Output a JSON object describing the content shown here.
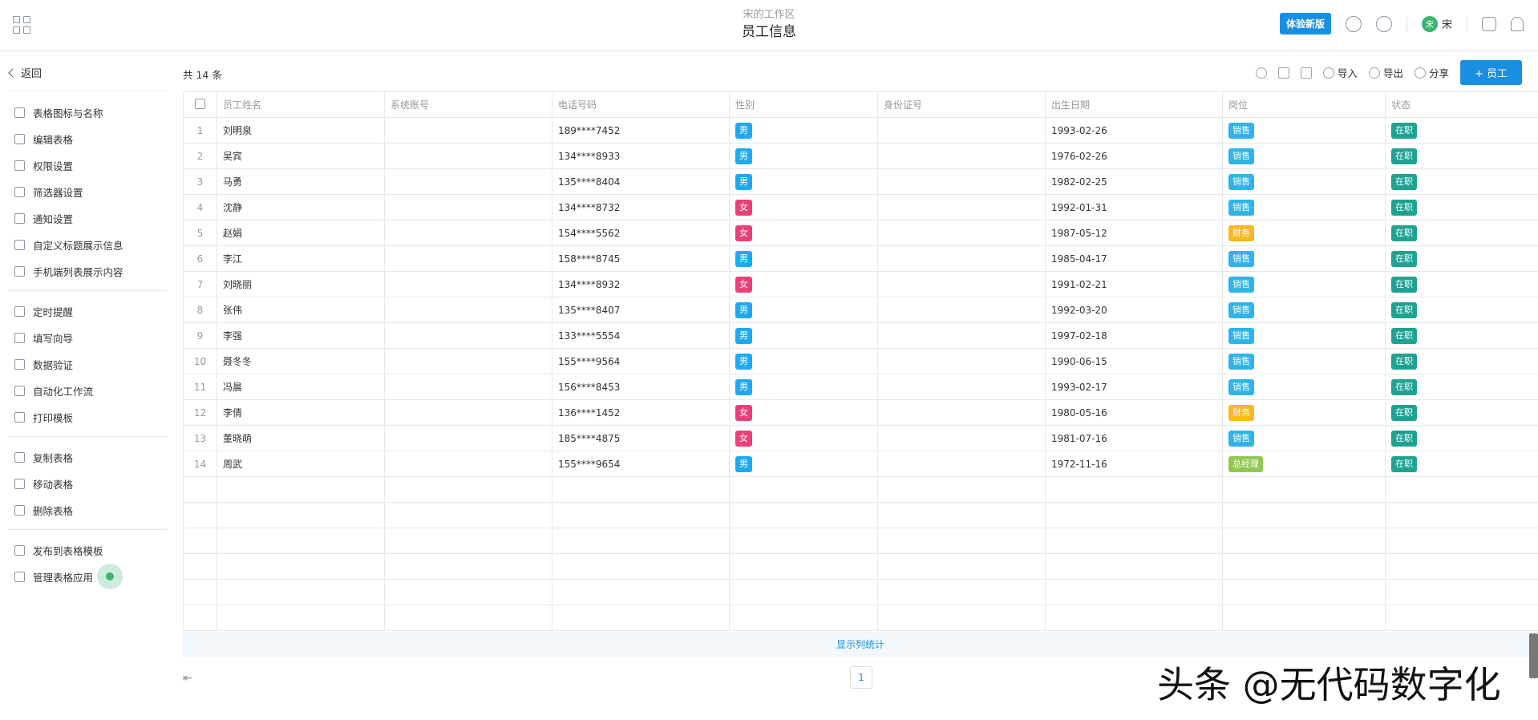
{
  "header": {
    "workspace": "宋的工作区",
    "title": "员工信息",
    "beta_label": "体验新版",
    "user_initial": "宋",
    "user_name": "宋"
  },
  "sidebar": {
    "back_label": "返回",
    "groups": [
      [
        "表格图标与名称",
        "编辑表格",
        "权限设置",
        "筛选器设置",
        "通知设置",
        "自定义标题展示信息",
        "手机端列表展示内容"
      ],
      [
        "定时提醒",
        "填写向导",
        "数据验证",
        "自动化工作流",
        "打印模板"
      ],
      [
        "复制表格",
        "移动表格",
        "删除表格"
      ],
      [
        "发布到表格模板",
        "管理表格应用"
      ]
    ]
  },
  "toolbar": {
    "count": "共 14 条",
    "import": "导入",
    "export": "导出",
    "share": "分享",
    "add": "+ 员工"
  },
  "table": {
    "columns": [
      "员工姓名",
      "系统账号",
      "电话号码",
      "性别",
      "身份证号",
      "出生日期",
      "岗位",
      "状态"
    ],
    "rows": [
      {
        "n": "1",
        "name": "刘明泉",
        "phone": "189****7452",
        "gender": "男",
        "birth": "1993-02-26",
        "post": "销售",
        "status": "在职"
      },
      {
        "n": "2",
        "name": "吴宾",
        "phone": "134****8933",
        "gender": "男",
        "birth": "1976-02-26",
        "post": "销售",
        "status": "在职"
      },
      {
        "n": "3",
        "name": "马勇",
        "phone": "135****8404",
        "gender": "男",
        "birth": "1982-02-25",
        "post": "销售",
        "status": "在职"
      },
      {
        "n": "4",
        "name": "沈静",
        "phone": "134****8732",
        "gender": "女",
        "birth": "1992-01-31",
        "post": "销售",
        "status": "在职"
      },
      {
        "n": "5",
        "name": "赵娟",
        "phone": "154****5562",
        "gender": "女",
        "birth": "1987-05-12",
        "post": "财务",
        "status": "在职"
      },
      {
        "n": "6",
        "name": "李江",
        "phone": "158****8745",
        "gender": "男",
        "birth": "1985-04-17",
        "post": "销售",
        "status": "在职"
      },
      {
        "n": "7",
        "name": "刘晓丽",
        "phone": "134****8932",
        "gender": "女",
        "birth": "1991-02-21",
        "post": "销售",
        "status": "在职"
      },
      {
        "n": "8",
        "name": "张伟",
        "phone": "135****8407",
        "gender": "男",
        "birth": "1992-03-20",
        "post": "销售",
        "status": "在职"
      },
      {
        "n": "9",
        "name": "李强",
        "phone": "133****5554",
        "gender": "男",
        "birth": "1997-02-18",
        "post": "销售",
        "status": "在职"
      },
      {
        "n": "10",
        "name": "聂冬冬",
        "phone": "155****9564",
        "gender": "男",
        "birth": "1990-06-15",
        "post": "销售",
        "status": "在职"
      },
      {
        "n": "11",
        "name": "冯晨",
        "phone": "156****8453",
        "gender": "男",
        "birth": "1993-02-17",
        "post": "销售",
        "status": "在职"
      },
      {
        "n": "12",
        "name": "李倩",
        "phone": "136****1452",
        "gender": "女",
        "birth": "1980-05-16",
        "post": "财务",
        "status": "在职"
      },
      {
        "n": "13",
        "name": "董晓萌",
        "phone": "185****4875",
        "gender": "女",
        "birth": "1981-07-16",
        "post": "销售",
        "status": "在职"
      },
      {
        "n": "14",
        "name": "周武",
        "phone": "155****9654",
        "gender": "男",
        "birth": "1972-11-16",
        "post": "总经理",
        "status": "在职"
      }
    ]
  },
  "colors": {
    "男": "#1eaaf1",
    "女": "#e8407a",
    "销售": "#2fb4ea",
    "财务": "#f8b821",
    "总经理": "#8fc852",
    "在职": "#1fa292"
  },
  "footer": {
    "stats_label": "显示列统计",
    "page": "1"
  },
  "watermark": "头条 @无代码数字化"
}
